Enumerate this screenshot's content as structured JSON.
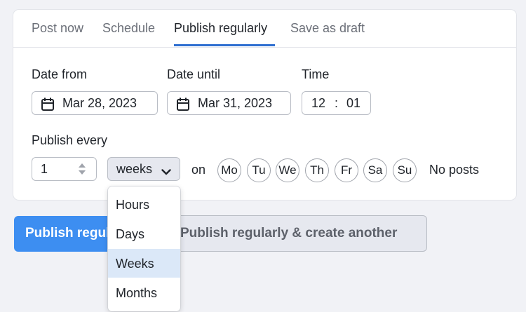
{
  "tabs": {
    "post_now": "Post now",
    "schedule": "Schedule",
    "publish_regularly": "Publish regularly",
    "save_as_draft": "Save as draft",
    "active": "publish_regularly"
  },
  "form": {
    "date_from_label": "Date from",
    "date_from_value": "Mar 28, 2023",
    "date_until_label": "Date until",
    "date_until_value": "Mar 31, 2023",
    "time_label": "Time",
    "time_hour": "12",
    "time_sep": ":",
    "time_minute": "01",
    "publish_every_label": "Publish every",
    "interval_value": "1",
    "unit_value": "weeks",
    "on_label": "on",
    "days": [
      "Mo",
      "Tu",
      "We",
      "Th",
      "Fr",
      "Sa",
      "Su"
    ],
    "no_posts_text": "No posts"
  },
  "unit_dropdown": {
    "options": [
      "Hours",
      "Days",
      "Weeks",
      "Months"
    ],
    "selected": "Weeks"
  },
  "buttons": {
    "publish": "Publish regularly",
    "publish_and_create": "Publish regularly & create another"
  },
  "colors": {
    "accent": "#2f6fd0",
    "primary_button": "#3d8ef1",
    "selected_option_bg": "#dbe8f8"
  }
}
